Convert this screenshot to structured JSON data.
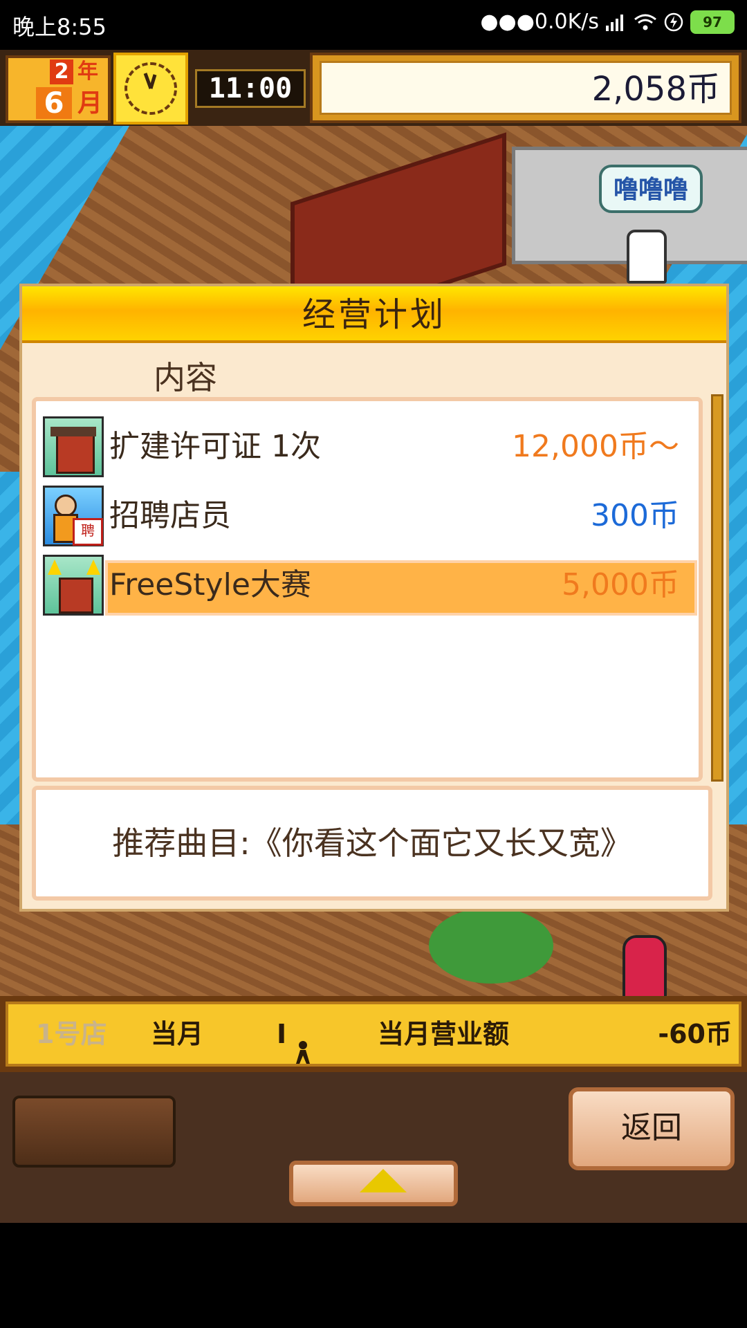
{
  "status_bar": {
    "time": "晚上8:55",
    "network": "●●●0.0K/s",
    "battery": "97",
    "icons": [
      "signal-icon",
      "wifi-icon",
      "charging-icon",
      "battery-icon"
    ]
  },
  "hud": {
    "year_num": "2",
    "year_unit": "年",
    "month_num": "6",
    "month_unit": "月",
    "time": "11:00",
    "money": "2,058币"
  },
  "scene": {
    "speech": "噜噜噜"
  },
  "dialog": {
    "title": "经营计划",
    "column_label": "内容",
    "items": [
      {
        "label": "扩建许可证 1次",
        "price": "12,000币～",
        "price_color": "#f07a1e",
        "icon": "building-icon",
        "selected": false
      },
      {
        "label": "招聘店员",
        "price": "300币",
        "price_color": "#1c6ad8",
        "icon": "hire-staff-icon",
        "selected": false
      },
      {
        "label": "FreeStyle大赛",
        "price": "5,000币",
        "price_color": "#f07a1e",
        "icon": "contest-building-icon",
        "selected": true
      }
    ],
    "tip": "推荐曲目:《你看这个面它又长又宽》"
  },
  "info_bar": {
    "store": "1号店",
    "month": "当月",
    "count": "I",
    "revenue_label": "当月营业额",
    "revenue": "-60币"
  },
  "controls": {
    "back_label": "返回"
  }
}
